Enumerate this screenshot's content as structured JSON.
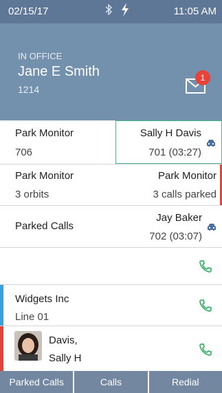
{
  "status_bar": {
    "date": "02/15/17",
    "time": "11:05 AM",
    "bluetooth_icon": "bluetooth-icon",
    "charging_icon": "lightning-bolt-icon"
  },
  "header": {
    "presence": "IN OFFICE",
    "name": "Jane E Smith",
    "extension": "1214",
    "voicemail_count": "1"
  },
  "rows": {
    "r1": {
      "left_label": "Park Monitor",
      "left_sub": "706",
      "right_label": "Sally H Davis",
      "right_sub": "701 (03:27)"
    },
    "r2": {
      "left_label": "Park Monitor",
      "left_sub": "3 orbits",
      "right_label": "Park Monitor",
      "right_sub": "3 calls parked"
    },
    "r3": {
      "left_label": "Parked Calls",
      "right_label": "Jay Baker",
      "right_sub": "702 (03:07)"
    },
    "r5": {
      "label": "Widgets Inc",
      "sub": "Line 01"
    },
    "r6": {
      "label_line1": "Davis,",
      "label_line2": "Sally H"
    }
  },
  "softkeys": [
    "Parked Calls",
    "Calls",
    "Redial"
  ],
  "colors": {
    "status_bar": "#5f7796",
    "header": "#7390ad",
    "accent_green": "#4fb58d",
    "alert_red": "#e0443c",
    "line_blue": "#3aa0dd",
    "softkey": "#7387a1"
  }
}
